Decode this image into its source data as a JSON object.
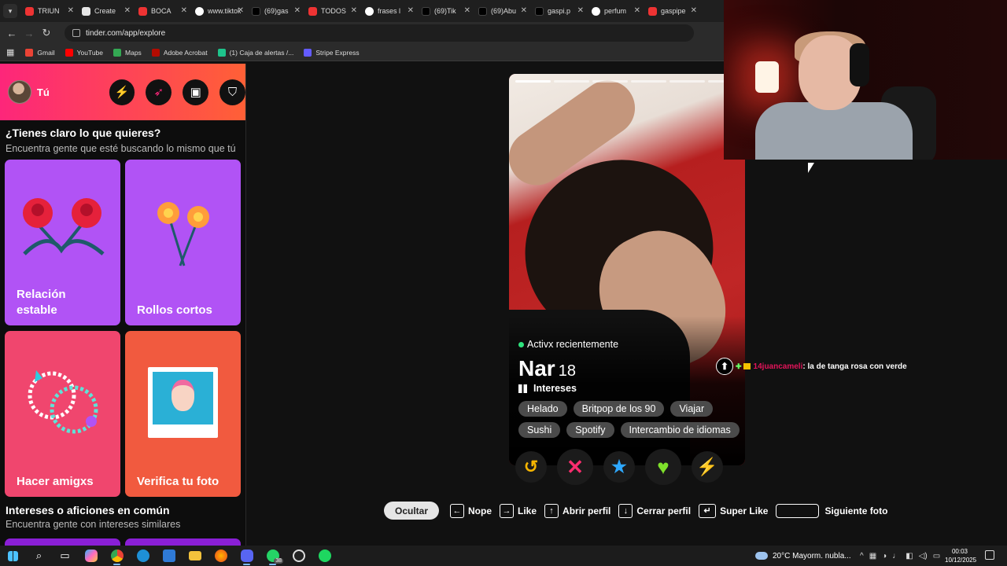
{
  "browser": {
    "tabs": [
      {
        "label": "TRIUN",
        "icon": "youtube-icon",
        "kind": "yt"
      },
      {
        "label": "Create",
        "icon": "page-icon",
        "kind": "blank"
      },
      {
        "label": "BOCA",
        "icon": "youtube-icon",
        "kind": "yt"
      },
      {
        "label": "www.tiktok",
        "icon": "globe-icon",
        "kind": "gl"
      },
      {
        "label": "(69)gas",
        "icon": "tiktok-icon",
        "kind": "tk"
      },
      {
        "label": "TODOS",
        "icon": "youtube-icon",
        "kind": "yt"
      },
      {
        "label": "frases l",
        "icon": "google-icon",
        "kind": "gl"
      },
      {
        "label": "(69)Tik",
        "icon": "tiktok-icon",
        "kind": "tk"
      },
      {
        "label": "(69)Abu",
        "icon": "tiktok-icon",
        "kind": "tk"
      },
      {
        "label": "gaspi.p",
        "icon": "tiktok-icon",
        "kind": "tk"
      },
      {
        "label": "perfum",
        "icon": "google-icon",
        "kind": "gl"
      },
      {
        "label": "gaspipe",
        "icon": "youtube-icon",
        "kind": "yt"
      }
    ],
    "url": "tinder.com/app/explore",
    "bookmarks": [
      {
        "label": "Gmail",
        "color": "#ea4335"
      },
      {
        "label": "YouTube",
        "color": "#ff0000"
      },
      {
        "label": "Maps",
        "color": "#34a853"
      },
      {
        "label": "Adobe Acrobat",
        "color": "#b30b00"
      },
      {
        "label": "(1) Caja de alertas /...",
        "color": "#1ec38b"
      },
      {
        "label": "Stripe Express",
        "color": "#635bff"
      }
    ]
  },
  "sidebar": {
    "user_label": "Tú",
    "section1_title": "¿Tienes claro lo que quieres?",
    "section1_sub": "Encuentra gente que esté buscando lo mismo que tú",
    "cards": [
      {
        "label": "Relación estable",
        "color": "#b153f5"
      },
      {
        "label": "Rollos cortos",
        "color": "#b153f5"
      },
      {
        "label": "Hacer amigxs",
        "color": "#f0466e"
      },
      {
        "label": "Verifica tu foto",
        "color": "#f15a3f"
      }
    ],
    "section2_title": "Intereses o aficiones en común",
    "section2_sub": "Encuentra gente con intereses similares"
  },
  "profile": {
    "status": "Activx recientemente",
    "name": "Nar",
    "age": "18",
    "interests_label": "Intereses",
    "interests": [
      "Helado",
      "Britpop de los 90",
      "Viajar",
      "Sushi",
      "Spotify",
      "Intercambio de idiomas"
    ]
  },
  "actions": {
    "rewind_color": "#f5b400",
    "nope_color": "#ff2d6f",
    "superlike_color": "#2ea8ff",
    "like_color": "#7ee02b",
    "boost_color": "#a445f0"
  },
  "hints": {
    "hide": "Ocultar",
    "nope": "Nope",
    "like": "Like",
    "open": "Abrir perfil",
    "close": "Cerrar perfil",
    "superlike": "Super Like",
    "next": "Siguiente foto"
  },
  "chat": {
    "user": "14juancameli",
    "message": ": la de tanga rosa con verde"
  },
  "taskbar": {
    "weather": "20°C  Mayorm. nubla...",
    "time": "00:03",
    "date": "10/12/2025",
    "whatsapp_badge": "38"
  }
}
